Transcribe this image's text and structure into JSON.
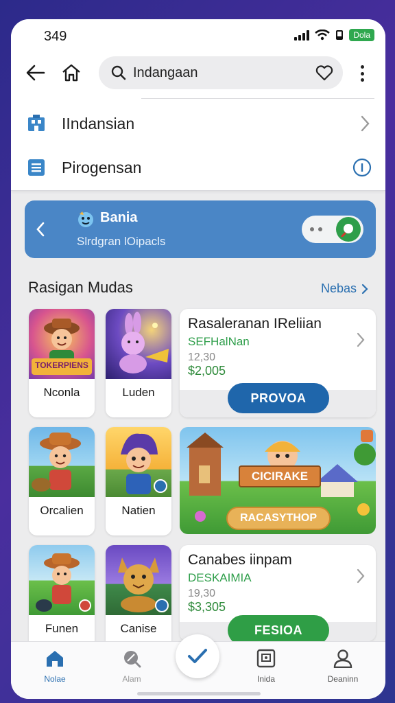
{
  "status": {
    "time": "349",
    "battery_label": "Dola"
  },
  "search": {
    "query": "Indangaan"
  },
  "menu": {
    "items": [
      {
        "label": "IIndansian",
        "icon": "building-icon",
        "right_icon": "chevron-right-icon"
      },
      {
        "label": "Pirogensan",
        "icon": "document-icon",
        "right_icon": "info-icon"
      }
    ]
  },
  "banner": {
    "title": "Bania",
    "subtitle": "Slrdgran lOipacls"
  },
  "section": {
    "title": "Rasigan Mudas",
    "more_label": "Nebas"
  },
  "tiles": [
    {
      "name": "Nconla",
      "art_text": "TOKERPIENS"
    },
    {
      "name": "Luden"
    },
    {
      "name": "Orcalien"
    },
    {
      "name": "Natien"
    },
    {
      "name": "Funen"
    },
    {
      "name": "Canise"
    }
  ],
  "cards": [
    {
      "title": "Rasaleranan IReliian",
      "tag": "SEFHalNan",
      "count": "12,30",
      "price": "$2,005",
      "button": "PROVOA",
      "button_color": "#1f66ab"
    },
    {
      "title": "Canabes iinpam",
      "tag": "DESKAIMIA",
      "count": "19,30",
      "price": "$3,305",
      "button": "FESIOA",
      "button_color": "#2f9e46"
    }
  ],
  "game_card": {
    "ribbon": "CICIRAKE",
    "button": "RACASYTHOP"
  },
  "tabbar": {
    "tabs": [
      {
        "label": "Nolae",
        "icon": "home-icon",
        "active": true
      },
      {
        "label": "Alam",
        "icon": "search-icon"
      },
      {
        "label": "Inida",
        "icon": "library-icon"
      },
      {
        "label": "Deaninn",
        "icon": "profile-icon"
      }
    ],
    "fab_icon": "check-icon"
  },
  "colors": {
    "accent": "#2a6fb0",
    "green": "#2e9e4a",
    "banner": "#4a86c6"
  }
}
